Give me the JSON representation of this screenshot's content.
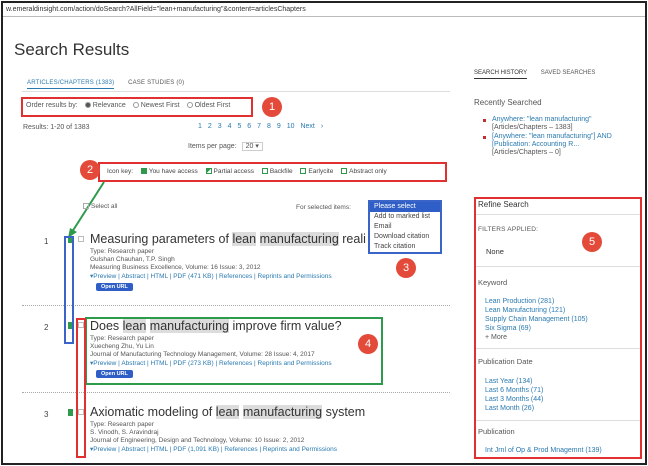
{
  "browser": {
    "url": "w.emeraldinsight.com/action/doSearch?AllField=\"lean+manufacturing\"&content=articlesChapters"
  },
  "page": {
    "title": "Search Results"
  },
  "tabs": [
    {
      "label": "ARTICLES/CHAPTERS (1383)"
    },
    {
      "label": "CASE STUDIES (0)"
    }
  ],
  "order": {
    "label": "Order results by:",
    "options": [
      "Relevance",
      "Newest First",
      "Oldest First"
    ],
    "selected": "Relevance"
  },
  "results_summary": {
    "count_text": "Results: 1-20 of 1383",
    "pages": [
      "1",
      "2",
      "3",
      "4",
      "5",
      "6",
      "7",
      "8",
      "9",
      "10",
      "Next ›"
    ],
    "items_per_page_label": "Items per page:",
    "items_per_page_value": "20"
  },
  "icon_key": {
    "label": "Icon key:",
    "items": [
      {
        "label": "You have access",
        "color": "#2e9a4c"
      },
      {
        "label": "Partial access",
        "color": "#2e9a4c"
      },
      {
        "label": "Backfile",
        "color": "#2e9a4c"
      },
      {
        "label": "Earlycite",
        "color": "#2e9a4c"
      },
      {
        "label": "Abstract only",
        "color": "#2e9a4c"
      }
    ]
  },
  "bulk": {
    "select_all": "Select all",
    "for_selected": "For selected items:",
    "actions": [
      "Please select",
      "Add to marked list",
      "Email",
      "Download citation",
      "Track citation"
    ]
  },
  "results": [
    {
      "num": "1",
      "title_parts": [
        "Measuring parameters of ",
        "lean",
        " ",
        "manufacturing",
        " reali"
      ],
      "type": "Type: Research paper",
      "authors": "Gulshan Chauhan, T.P. Singh",
      "source": "Measuring Business Excellence, Volume: 16 Issue: 3, 2012",
      "links": "▾Preview | Abstract | HTML | PDF (471 KB) | References | Reprints and Permissions",
      "button": "Open URL"
    },
    {
      "num": "2",
      "title_parts": [
        "Does ",
        "lean",
        " ",
        "manufacturing",
        " improve firm value?"
      ],
      "type": "Type: Research paper",
      "authors": "Xuecheng Zhu, Yu Lin",
      "source": "Journal of Manufacturing Technology Management, Volume: 28 Issue: 4, 2017",
      "links": "▾Preview | Abstract | HTML | PDF (273 KB) | References | Reprints and Permissions",
      "button": "Open URL"
    },
    {
      "num": "3",
      "title_parts": [
        "Axiomatic modeling of ",
        "lean",
        " ",
        "manufacturing",
        " system"
      ],
      "type": "Type: Research paper",
      "authors": "S. Vinodh, S. Aravindraj",
      "source": "Journal of Engineering, Design and Technology, Volume: 10 Issue: 2, 2012",
      "links": "▾Preview | Abstract | HTML | PDF (1,091 KB) | References | Reprints and Permissions"
    }
  ],
  "sidebar": {
    "tabs": [
      "SEARCH HISTORY",
      "SAVED SEARCHES"
    ],
    "recent_heading": "Recently Searched",
    "recent": [
      {
        "link": "Anywhere: \"lean manufacturing\"",
        "sub": "[Articles/Chapters – 1383]"
      },
      {
        "link": "[Anywhere: \"lean manufacturing\"] AND [Publication: Accounting R...",
        "sub": "[Articles/Chapters – 0]"
      }
    ],
    "refine": {
      "heading": "Refine Search",
      "filters_label": "FILTERS APPLIED:",
      "filters_value": "None",
      "keyword_heading": "Keyword",
      "keywords": [
        "Lean Production (281)",
        "Lean Manufacturing (121)",
        "Supply Chain Management (105)",
        "Six Sigma (69)"
      ],
      "more": "+ More",
      "date_heading": "Publication Date",
      "dates": [
        "Last Year (134)",
        "Last 6 Months (71)",
        "Last 3 Months (44)",
        "Last Month (26)"
      ],
      "publication_heading": "Publication",
      "publications": [
        "Int Jrnl of Op & Prod Mnagemnt (139)"
      ]
    }
  },
  "annotations": [
    "1",
    "2",
    "3",
    "4",
    "5"
  ],
  "colors": {
    "annotation_red": "#e03030",
    "annotation_green": "#2e9a4c",
    "annotation_blue": "#3a64c8",
    "link": "#2a7ab0"
  }
}
